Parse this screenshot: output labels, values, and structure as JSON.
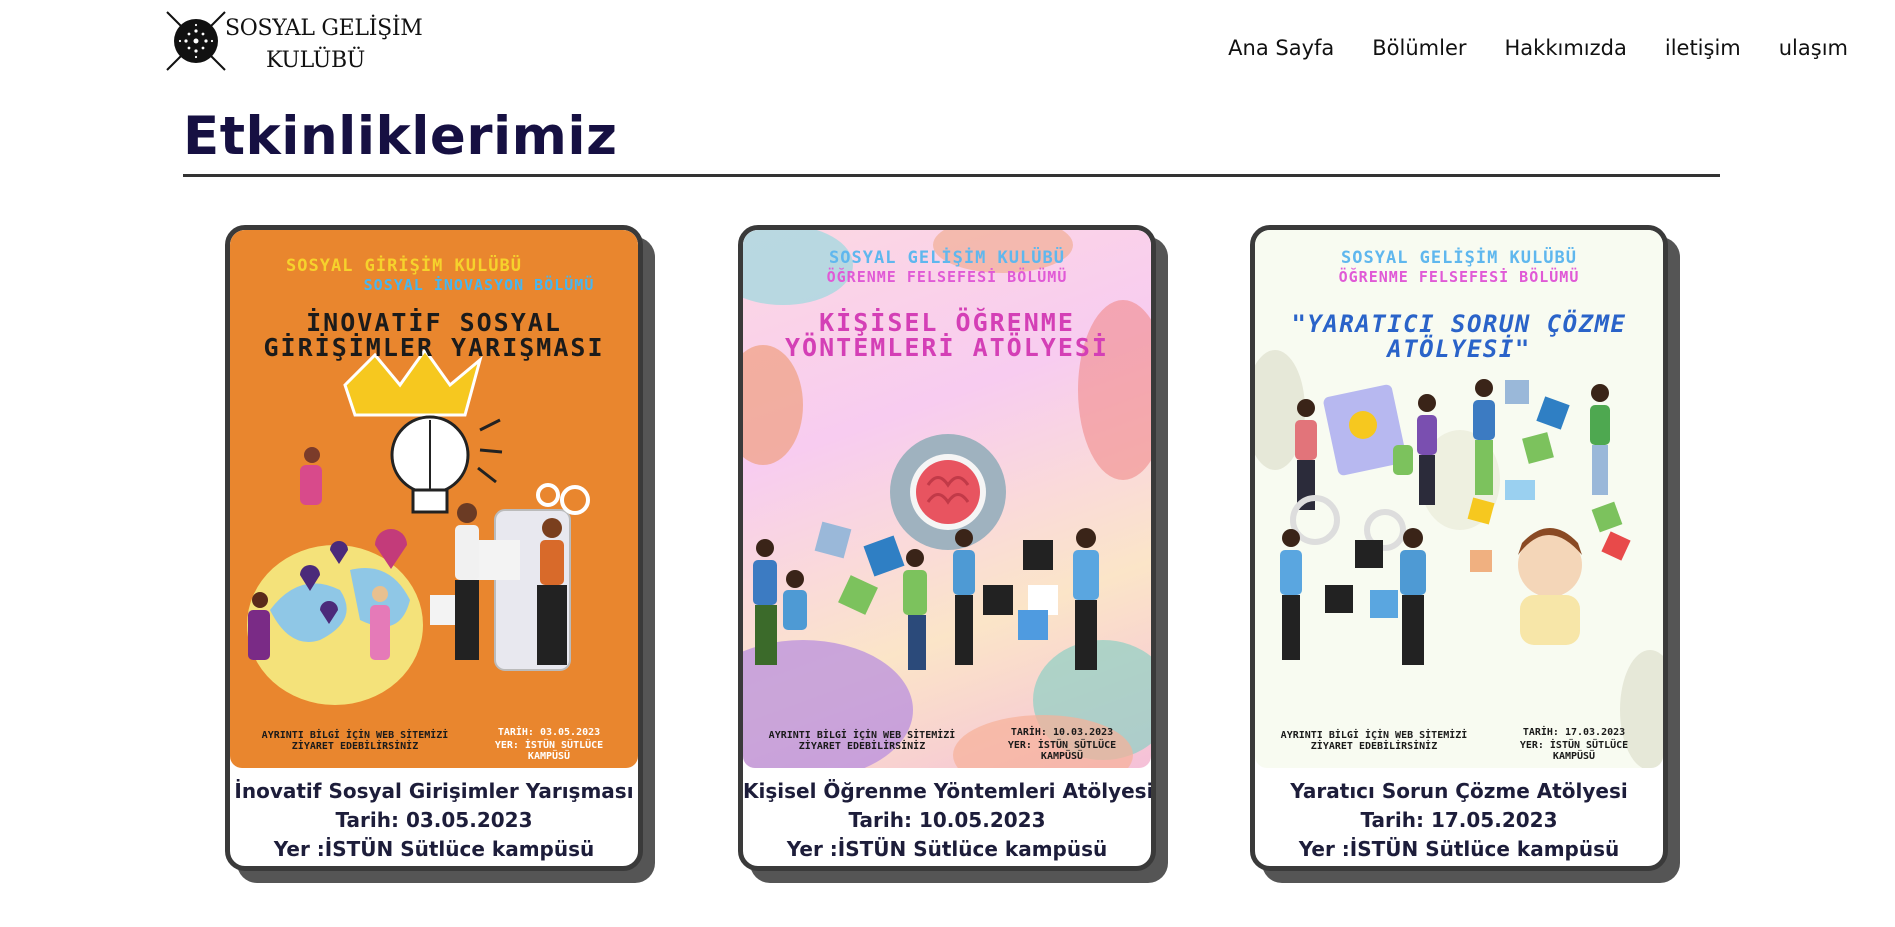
{
  "header": {
    "logo_line1": "SOSYAL GELİŞİM",
    "logo_line2": "KULÜBÜ",
    "nav": [
      "Ana Sayfa",
      "Bölümler",
      "Hakkımızda",
      "iletişim",
      "ulaşım"
    ]
  },
  "section": {
    "title": "Etkinliklerimiz"
  },
  "events": [
    {
      "poster": {
        "head1": "SOSYAL GİRİŞİM KULÜBÜ",
        "head2": "SOSYAL İNOVASYON BÖLÜMÜ",
        "title": "İNOVATİF SOSYAL GİRİŞİMLER YARIŞMASI",
        "footer_left": "AYRINTI BİLGİ İÇİN WEB SİTEMİZİ ZİYARET EDEBİLİRSİNİZ",
        "date": "TARİH: 03.05.2023",
        "place": "YER: İSTÜN SÜTLÜCE KAMPÜSÜ",
        "colors": {
          "head1": "#f6d22c",
          "head2": "#49b6ef",
          "title": "#1b1b1b"
        }
      },
      "name": "İnovatif Sosyal Girişimler Yarışması",
      "date": "Tarih: 03.05.2023",
      "place": "Yer :İSTÜN Sütlüce kampüsü"
    },
    {
      "poster": {
        "head1": "SOSYAL GELİŞİM KULÜBÜ",
        "head2": "ÖĞRENME FELSEFESİ BÖLÜMÜ",
        "title": "KİŞİSEL ÖĞRENME YÖNTEMLERİ ATÖLYESİ",
        "footer_left": "AYRINTI BİLGİ İÇİN WEB SİTEMİZİ ZİYARET EDEBİLİRSİNİZ",
        "date": "TARİH: 10.03.2023",
        "place": "YER: İSTÜN SÜTLÜCE KAMPÜSÜ",
        "colors": {
          "head1": "#5fb7ee",
          "head2": "#e05ad6",
          "title": "#d43fb6"
        }
      },
      "name": "Kişisel Öğrenme Yöntemleri Atölyesi",
      "date": "Tarih: 10.05.2023",
      "place": "Yer :İSTÜN Sütlüce kampüsü"
    },
    {
      "poster": {
        "head1": "SOSYAL GELİŞİM KULÜBÜ",
        "head2": "ÖĞRENME FELSEFESİ BÖLÜMÜ",
        "title": "\"YARATICI SORUN ÇÖZME ATÖLYESİ\"",
        "footer_left": "AYRINTI BİLGİ İÇİN WEB SİTEMİZİ ZİYARET EDEBİLİRSİNİZ",
        "date": "TARİH: 17.03.2023",
        "place": "YER: İSTÜN SÜTLÜCE KAMPÜSÜ",
        "colors": {
          "head1": "#5fb7ee",
          "head2": "#e05ad6",
          "title": "#2a63c9"
        }
      },
      "name": "Yaratıcı Sorun Çözme Atölyesi",
      "date": "Tarih: 17.05.2023",
      "place": "Yer :İSTÜN Sütlüce kampüsü"
    }
  ],
  "theme": {
    "title_color": "#161042",
    "card_border": "#3a3a3a",
    "card_shadow": "#555555"
  }
}
